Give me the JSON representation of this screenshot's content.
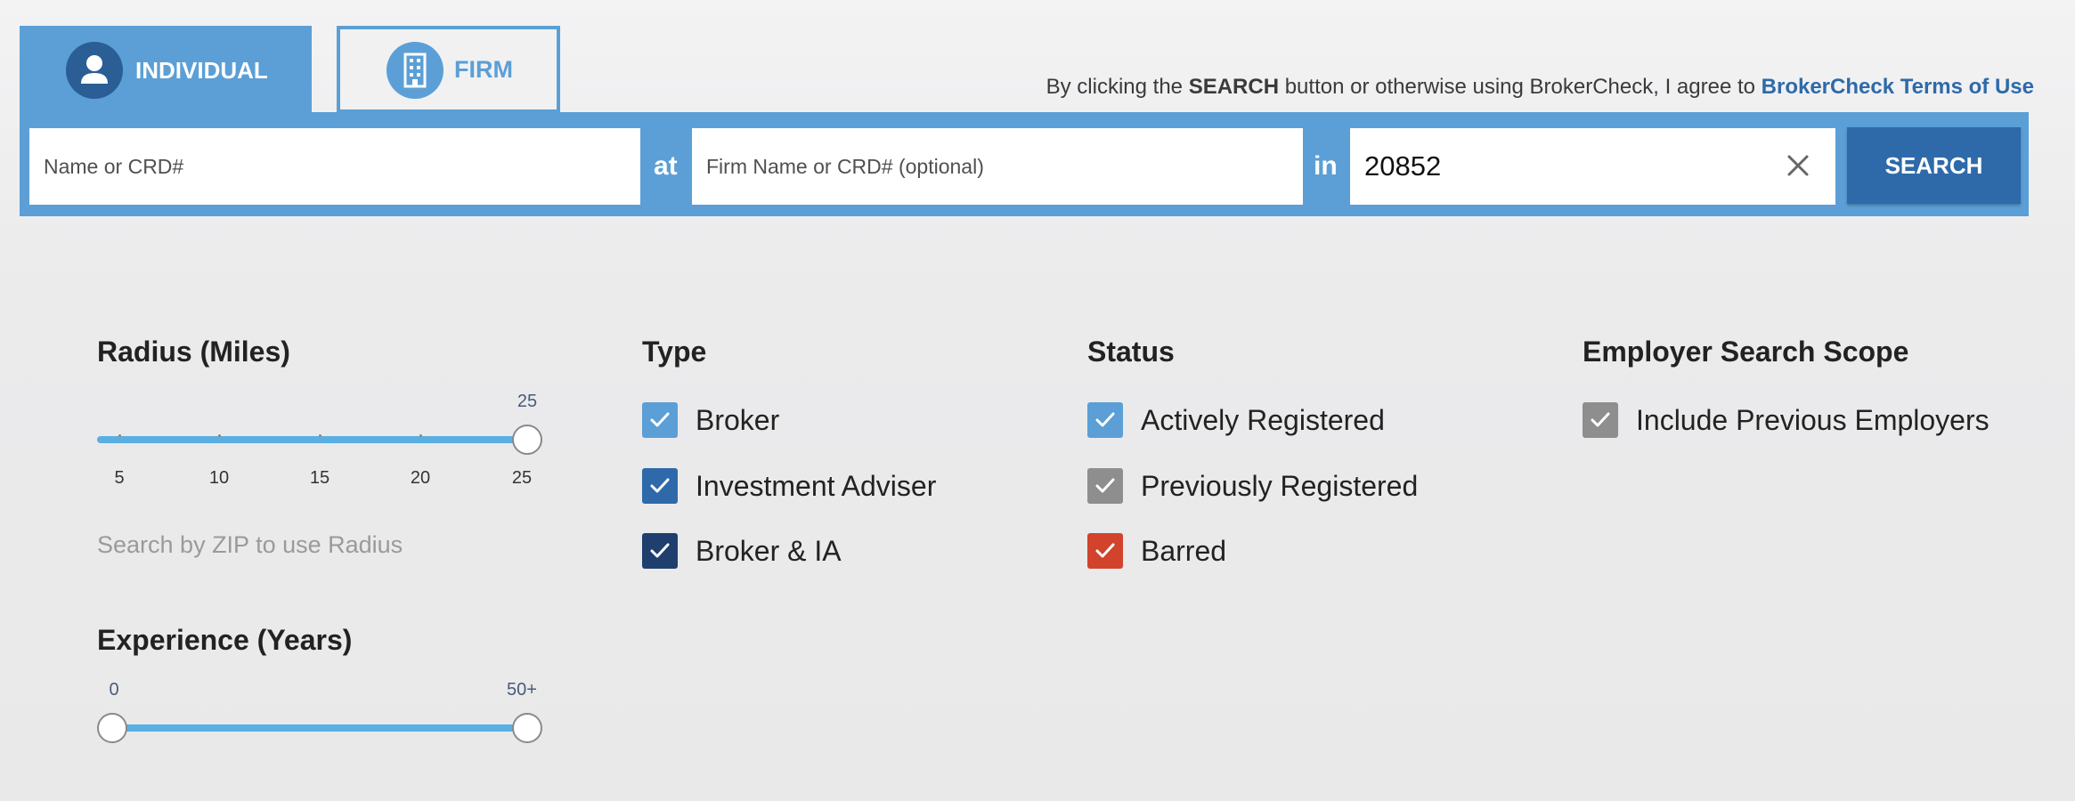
{
  "tabs": {
    "individual_label": "INDIVIDUAL",
    "firm_label": "FIRM"
  },
  "terms": {
    "prefix": "By clicking the ",
    "bold": "SEARCH",
    "middle": " button or otherwise using BrokerCheck, I agree to ",
    "link": "BrokerCheck Terms of Use"
  },
  "search": {
    "name_placeholder": "Name or CRD#",
    "at_label": "at",
    "firm_placeholder": "Firm Name or CRD# (optional)",
    "in_label": "in",
    "location_value": "20852",
    "button_label": "SEARCH"
  },
  "radius": {
    "title": "Radius (Miles)",
    "current_value": "25",
    "ticks": [
      "5",
      "10",
      "15",
      "20",
      "25"
    ],
    "hint": "Search by ZIP to use Radius"
  },
  "experience": {
    "title": "Experience (Years)",
    "min_value": "0",
    "max_value": "50+"
  },
  "type": {
    "title": "Type",
    "options": [
      {
        "label": "Broker",
        "checked": true,
        "color": "#5b9fd6"
      },
      {
        "label": "Investment Adviser",
        "checked": true,
        "color": "#2e6aa9"
      },
      {
        "label": "Broker & IA",
        "checked": true,
        "color": "#1f3f6e"
      }
    ]
  },
  "status": {
    "title": "Status",
    "options": [
      {
        "label": "Actively Registered",
        "checked": true,
        "color": "#5b9fd6"
      },
      {
        "label": "Previously Registered",
        "checked": true,
        "color": "#8e8e8e"
      },
      {
        "label": "Barred",
        "checked": true,
        "color": "#d2432c"
      }
    ]
  },
  "scope": {
    "title": "Employer Search Scope",
    "options": [
      {
        "label": "Include Previous Employers",
        "checked": true,
        "color": "#8e8e8e"
      }
    ]
  },
  "colors": {
    "accent": "#5b9fd6",
    "dark_blue": "#2e6aa9",
    "slider": "#5aafe2"
  },
  "icons": {
    "individual": "person-icon",
    "firm": "building-icon",
    "clear": "close-icon",
    "check": "check-icon"
  }
}
